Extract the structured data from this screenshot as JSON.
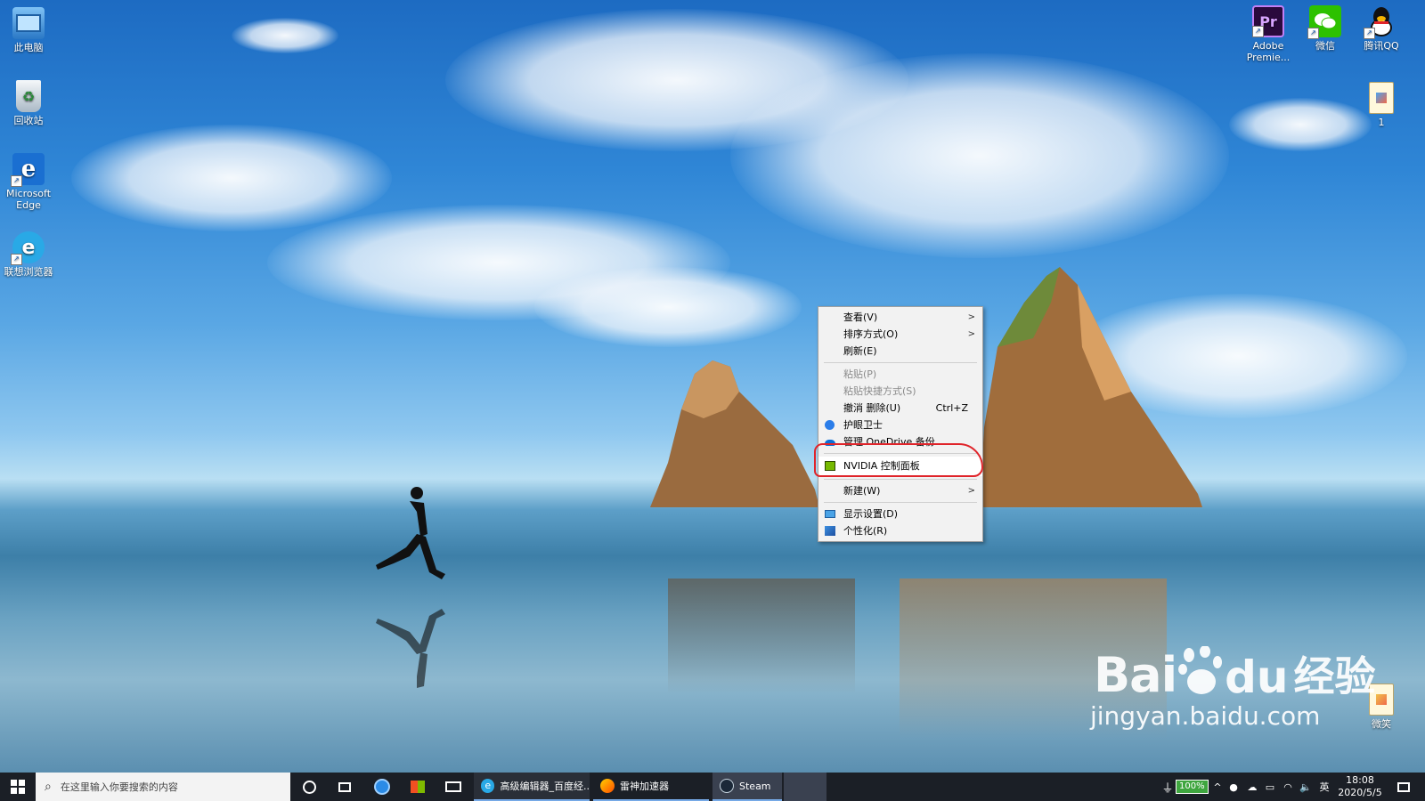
{
  "desktop": {
    "left_icons": [
      {
        "label": "此电脑",
        "icon": "computer-icon"
      },
      {
        "label": "回收站",
        "icon": "recycle-bin-icon"
      },
      {
        "label": "Microsoft Edge",
        "icon": "edge-icon"
      },
      {
        "label": "联想浏览器",
        "icon": "lenovo-browser-icon"
      }
    ],
    "right_icons": [
      {
        "label": "Adobe Premie...",
        "icon": "premiere-icon",
        "glyph": "Pr"
      },
      {
        "label": "微信",
        "icon": "wechat-icon"
      },
      {
        "label": "腾讯QQ",
        "icon": "qq-icon"
      },
      {
        "label": "1",
        "icon": "file-icon"
      },
      {
        "label": "微笑",
        "icon": "file-icon"
      }
    ]
  },
  "context_menu": {
    "items": [
      {
        "label": "查看(V)",
        "submenu": true
      },
      {
        "label": "排序方式(O)",
        "submenu": true
      },
      {
        "label": "刷新(E)"
      },
      {
        "label": "粘贴(P)",
        "disabled": true
      },
      {
        "label": "粘贴快捷方式(S)",
        "disabled": true
      },
      {
        "label": "撤消 删除(U)",
        "accelerator": "Ctrl+Z"
      },
      {
        "label": "护眼卫士",
        "icon": "eye-guard-icon"
      },
      {
        "label": "管理 OneDrive 备份",
        "icon": "onedrive-icon"
      },
      {
        "label": "NVIDIA 控制面板",
        "icon": "nvidia-icon",
        "highlighted": true
      },
      {
        "label": "新建(W)",
        "submenu": true
      },
      {
        "label": "显示设置(D)",
        "icon": "display-icon"
      },
      {
        "label": "个性化(R)",
        "icon": "personalize-icon"
      }
    ]
  },
  "taskbar": {
    "search_placeholder": "在这里输入你要搜索的内容",
    "apps": [
      {
        "label": "高级编辑器_百度经...",
        "icon": "edge-icon"
      },
      {
        "label": "雷神加速器",
        "icon": "leishen-icon"
      },
      {
        "label": "Steam",
        "icon": "steam-icon"
      }
    ],
    "battery": "100%",
    "ime": "英",
    "time": "18:08",
    "date": "2020/5/5"
  },
  "watermark": {
    "brand": "Bai",
    "brand_tail": "du",
    "suffix": "经验",
    "url": "jingyan.baidu.com"
  },
  "colors": {
    "highlight_circle": "#e0242a",
    "taskbar": "#1b1f26",
    "menu_bg": "#f2f2f2"
  }
}
